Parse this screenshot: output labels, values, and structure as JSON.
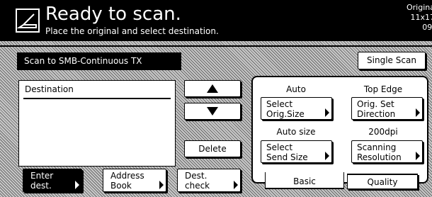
{
  "header": {
    "title": "Ready to scan.",
    "subtitle": "Place the original and select destination.",
    "original_label": "Origina",
    "original_size": "11x17",
    "original_date": "09/"
  },
  "job": {
    "mode_label": "Scan to SMB-Continuous TX",
    "single_scan_label": "Single Scan"
  },
  "destination": {
    "header": "Destination",
    "delete_label": "Delete"
  },
  "settings": {
    "orig_size": {
      "value": "Auto",
      "line1": "Select",
      "line2": "Orig.Size"
    },
    "orig_direction": {
      "value": "Top Edge",
      "line1": "Orig. Set",
      "line2": "Direction"
    },
    "send_size": {
      "value": "Auto size",
      "line1": "Select",
      "line2": "Send Size"
    },
    "resolution": {
      "value": "200dpi",
      "line1": "Scanning",
      "line2": "Resolution"
    },
    "tabs": [
      "Basic",
      "Quality"
    ]
  },
  "bottom": {
    "enter_dest": {
      "line1": "Enter",
      "line2": "dest."
    },
    "address_book": {
      "line1": "Address",
      "line2": "Book"
    },
    "dest_check": {
      "line1": "Dest.",
      "line2": "check"
    }
  },
  "icons": {
    "status": "document-icon",
    "up": "arrow-up-icon",
    "down": "arrow-down-icon",
    "submenu": "triangle-right-icon"
  },
  "colors": {
    "background": "#000000",
    "panel": "#ffffff",
    "hatch": "#c9c9c9"
  }
}
